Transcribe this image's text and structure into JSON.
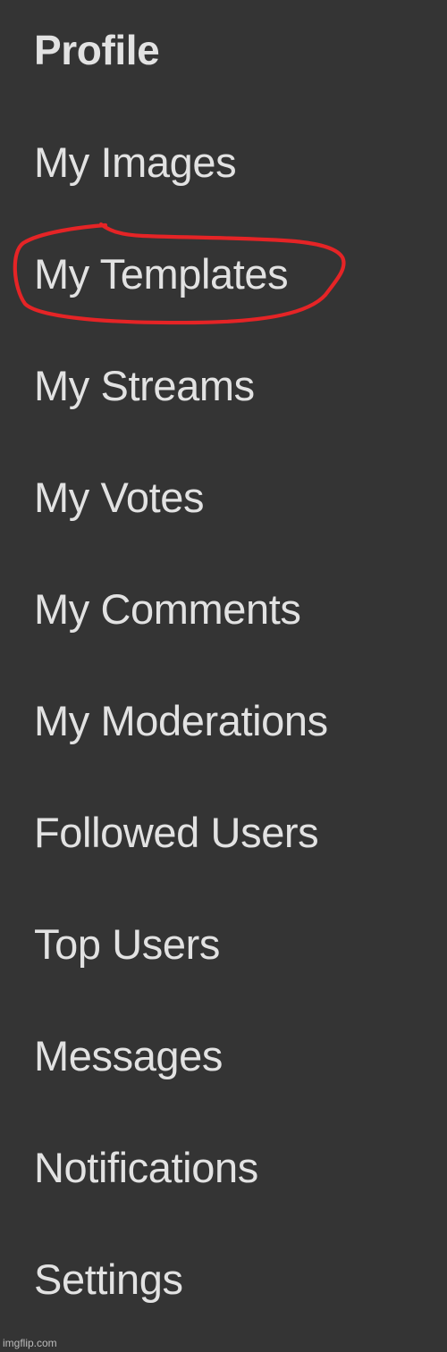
{
  "menu": {
    "items": [
      {
        "id": "profile",
        "label": "Profile"
      },
      {
        "id": "my-images",
        "label": "My Images"
      },
      {
        "id": "my-templates",
        "label": "My Templates"
      },
      {
        "id": "my-streams",
        "label": "My Streams"
      },
      {
        "id": "my-votes",
        "label": "My Votes"
      },
      {
        "id": "my-comments",
        "label": "My Comments"
      },
      {
        "id": "my-moderations",
        "label": "My Moderations"
      },
      {
        "id": "followed-users",
        "label": "Followed Users"
      },
      {
        "id": "top-users",
        "label": "Top Users"
      },
      {
        "id": "messages",
        "label": "Messages"
      },
      {
        "id": "notifications",
        "label": "Notifications"
      },
      {
        "id": "settings",
        "label": "Settings"
      }
    ]
  },
  "annotation": {
    "color": "#e52426"
  },
  "watermark": {
    "text": "imgflip.com"
  },
  "colors": {
    "background": "#343434",
    "text": "#e2e2e2"
  }
}
